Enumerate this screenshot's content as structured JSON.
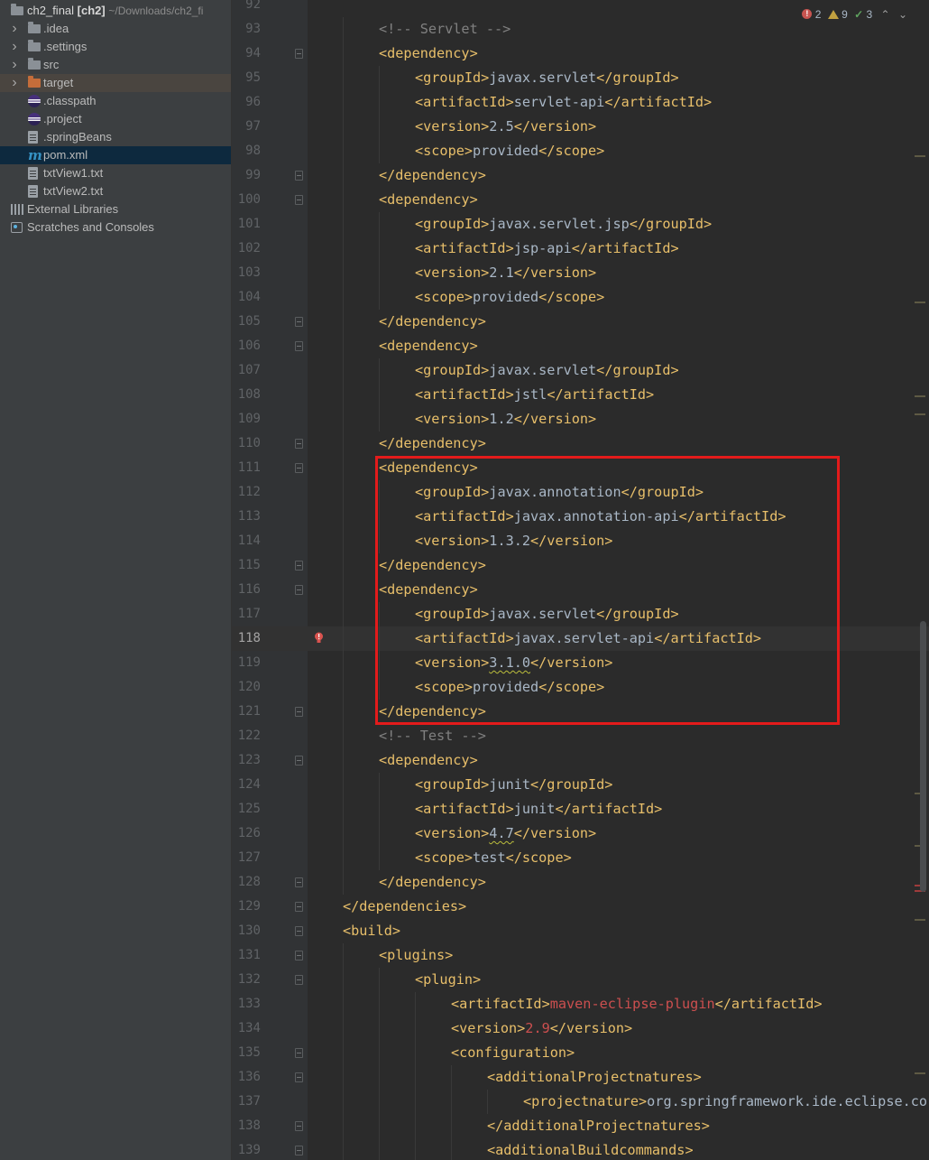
{
  "sidebar": {
    "root": {
      "name": "ch2_final",
      "module": "[ch2]",
      "path": "~/Downloads/ch2_fi"
    },
    "items": [
      {
        "label": ".idea",
        "kind": "folder",
        "expandable": true
      },
      {
        "label": ".settings",
        "kind": "folder",
        "expandable": true
      },
      {
        "label": "src",
        "kind": "folder",
        "expandable": true
      },
      {
        "label": "target",
        "kind": "folder-orange",
        "expandable": true
      },
      {
        "label": ".classpath",
        "kind": "eclipse-file"
      },
      {
        "label": ".project",
        "kind": "eclipse-file"
      },
      {
        "label": ".springBeans",
        "kind": "file"
      },
      {
        "label": "pom.xml",
        "kind": "maven-file",
        "selected": true
      },
      {
        "label": "txtView1.txt",
        "kind": "file"
      },
      {
        "label": "txtView2.txt",
        "kind": "file"
      }
    ],
    "external_libraries": "External Libraries",
    "scratches": "Scratches and Consoles"
  },
  "inspections": {
    "errors": "2",
    "warnings": "9",
    "weak_warnings": "3"
  },
  "editor": {
    "first_partial_line": "92",
    "current_line": "118",
    "lines": [
      {
        "n": "93",
        "indent": 2,
        "parts": [
          [
            "cmt",
            "<!-- Servlet -->"
          ]
        ]
      },
      {
        "n": "94",
        "indent": 2,
        "fold": "open",
        "parts": [
          [
            "tag",
            "<dependency>"
          ]
        ]
      },
      {
        "n": "95",
        "indent": 3,
        "parts": [
          [
            "tag",
            "<groupId>"
          ],
          [
            "txt",
            "javax.servlet"
          ],
          [
            "tag",
            "</groupId>"
          ]
        ]
      },
      {
        "n": "96",
        "indent": 3,
        "parts": [
          [
            "tag",
            "<artifactId>"
          ],
          [
            "txt",
            "servlet-api"
          ],
          [
            "tag",
            "</artifactId>"
          ]
        ]
      },
      {
        "n": "97",
        "indent": 3,
        "parts": [
          [
            "tag",
            "<version>"
          ],
          [
            "txt",
            "2.5"
          ],
          [
            "tag",
            "</version>"
          ]
        ]
      },
      {
        "n": "98",
        "indent": 3,
        "parts": [
          [
            "tag",
            "<scope>"
          ],
          [
            "txt",
            "provided"
          ],
          [
            "tag",
            "</scope>"
          ]
        ]
      },
      {
        "n": "99",
        "indent": 2,
        "fold": "close",
        "parts": [
          [
            "tag",
            "</dependency>"
          ]
        ]
      },
      {
        "n": "100",
        "indent": 2,
        "fold": "open",
        "parts": [
          [
            "tag",
            "<dependency>"
          ]
        ]
      },
      {
        "n": "101",
        "indent": 3,
        "parts": [
          [
            "tag",
            "<groupId>"
          ],
          [
            "txt",
            "javax.servlet.jsp"
          ],
          [
            "tag",
            "</groupId>"
          ]
        ]
      },
      {
        "n": "102",
        "indent": 3,
        "parts": [
          [
            "tag",
            "<artifactId>"
          ],
          [
            "txt",
            "jsp-api"
          ],
          [
            "tag",
            "</artifactId>"
          ]
        ]
      },
      {
        "n": "103",
        "indent": 3,
        "parts": [
          [
            "tag",
            "<version>"
          ],
          [
            "txt",
            "2.1"
          ],
          [
            "tag",
            "</version>"
          ]
        ]
      },
      {
        "n": "104",
        "indent": 3,
        "parts": [
          [
            "tag",
            "<scope>"
          ],
          [
            "txt",
            "provided"
          ],
          [
            "tag",
            "</scope>"
          ]
        ]
      },
      {
        "n": "105",
        "indent": 2,
        "fold": "close",
        "parts": [
          [
            "tag",
            "</dependency>"
          ]
        ]
      },
      {
        "n": "106",
        "indent": 2,
        "fold": "open",
        "parts": [
          [
            "tag",
            "<dependency>"
          ]
        ]
      },
      {
        "n": "107",
        "indent": 3,
        "parts": [
          [
            "tag",
            "<groupId>"
          ],
          [
            "txt",
            "javax.servlet"
          ],
          [
            "tag",
            "</groupId>"
          ]
        ]
      },
      {
        "n": "108",
        "indent": 3,
        "parts": [
          [
            "tag",
            "<artifactId>"
          ],
          [
            "txt",
            "jstl"
          ],
          [
            "tag",
            "</artifactId>"
          ]
        ]
      },
      {
        "n": "109",
        "indent": 3,
        "parts": [
          [
            "tag",
            "<version>"
          ],
          [
            "txt",
            "1.2"
          ],
          [
            "tag",
            "</version>"
          ]
        ]
      },
      {
        "n": "110",
        "indent": 2,
        "fold": "close",
        "parts": [
          [
            "tag",
            "</dependency>"
          ]
        ]
      },
      {
        "n": "111",
        "indent": 2,
        "fold": "open",
        "parts": [
          [
            "tag",
            "<dependency>"
          ]
        ]
      },
      {
        "n": "112",
        "indent": 3,
        "parts": [
          [
            "tag",
            "<groupId>"
          ],
          [
            "txt",
            "javax.annotation"
          ],
          [
            "tag",
            "</groupId>"
          ]
        ]
      },
      {
        "n": "113",
        "indent": 3,
        "parts": [
          [
            "tag",
            "<artifactId>"
          ],
          [
            "txt",
            "javax.annotation-api"
          ],
          [
            "tag",
            "</artifactId>"
          ]
        ]
      },
      {
        "n": "114",
        "indent": 3,
        "parts": [
          [
            "tag",
            "<version>"
          ],
          [
            "txt",
            "1.3.2"
          ],
          [
            "tag",
            "</version>"
          ]
        ]
      },
      {
        "n": "115",
        "indent": 2,
        "fold": "close",
        "parts": [
          [
            "tag",
            "</dependency>"
          ]
        ]
      },
      {
        "n": "116",
        "indent": 2,
        "fold": "open",
        "parts": [
          [
            "tag",
            "<dependency>"
          ]
        ]
      },
      {
        "n": "117",
        "indent": 3,
        "parts": [
          [
            "tag",
            "<groupId>"
          ],
          [
            "txt",
            "javax.servlet"
          ],
          [
            "tag",
            "</groupId>"
          ]
        ]
      },
      {
        "n": "118",
        "indent": 3,
        "bulb": true,
        "parts": [
          [
            "tag",
            "<artifactId>"
          ],
          [
            "txt",
            "javax.servlet-api"
          ],
          [
            "tag",
            "</artifactId>"
          ]
        ]
      },
      {
        "n": "119",
        "indent": 3,
        "parts": [
          [
            "tag",
            "<version>"
          ],
          [
            "squig",
            "3.1.0"
          ],
          [
            "tag",
            "</version>"
          ]
        ]
      },
      {
        "n": "120",
        "indent": 3,
        "parts": [
          [
            "tag",
            "<scope>"
          ],
          [
            "txt",
            "provided"
          ],
          [
            "tag",
            "</scope>"
          ]
        ]
      },
      {
        "n": "121",
        "indent": 2,
        "fold": "close",
        "parts": [
          [
            "tag",
            "</dependency>"
          ]
        ]
      },
      {
        "n": "122",
        "indent": 2,
        "parts": [
          [
            "cmt",
            "<!-- Test -->"
          ]
        ]
      },
      {
        "n": "123",
        "indent": 2,
        "fold": "open",
        "parts": [
          [
            "tag",
            "<dependency>"
          ]
        ]
      },
      {
        "n": "124",
        "indent": 3,
        "parts": [
          [
            "tag",
            "<groupId>"
          ],
          [
            "txt",
            "junit"
          ],
          [
            "tag",
            "</groupId>"
          ]
        ]
      },
      {
        "n": "125",
        "indent": 3,
        "parts": [
          [
            "tag",
            "<artifactId>"
          ],
          [
            "txt",
            "junit"
          ],
          [
            "tag",
            "</artifactId>"
          ]
        ]
      },
      {
        "n": "126",
        "indent": 3,
        "parts": [
          [
            "tag",
            "<version>"
          ],
          [
            "squig",
            "4.7"
          ],
          [
            "tag",
            "</version>"
          ]
        ]
      },
      {
        "n": "127",
        "indent": 3,
        "parts": [
          [
            "tag",
            "<scope>"
          ],
          [
            "txt",
            "test"
          ],
          [
            "tag",
            "</scope>"
          ]
        ]
      },
      {
        "n": "128",
        "indent": 2,
        "fold": "close",
        "parts": [
          [
            "tag",
            "</dependency>"
          ]
        ]
      },
      {
        "n": "129",
        "indent": 1,
        "fold": "close",
        "parts": [
          [
            "tag",
            "</dependencies>"
          ]
        ]
      },
      {
        "n": "130",
        "indent": 1,
        "fold": "open",
        "parts": [
          [
            "tag",
            "<build>"
          ]
        ]
      },
      {
        "n": "131",
        "indent": 2,
        "fold": "open",
        "parts": [
          [
            "tag",
            "<plugins>"
          ]
        ]
      },
      {
        "n": "132",
        "indent": 3,
        "fold": "open",
        "parts": [
          [
            "tag",
            "<plugin>"
          ]
        ]
      },
      {
        "n": "133",
        "indent": 4,
        "parts": [
          [
            "tag",
            "<artifactId>"
          ],
          [
            "red",
            "maven-eclipse-plugin"
          ],
          [
            "tag",
            "</artifactId>"
          ]
        ]
      },
      {
        "n": "134",
        "indent": 4,
        "parts": [
          [
            "tag",
            "<version>"
          ],
          [
            "red",
            "2.9"
          ],
          [
            "tag",
            "</version>"
          ]
        ]
      },
      {
        "n": "135",
        "indent": 4,
        "fold": "open",
        "parts": [
          [
            "tag",
            "<configuration>"
          ]
        ]
      },
      {
        "n": "136",
        "indent": 5,
        "fold": "open",
        "parts": [
          [
            "tag",
            "<additionalProjectnatures>"
          ]
        ]
      },
      {
        "n": "137",
        "indent": 6,
        "parts": [
          [
            "tag",
            "<projectnature>"
          ],
          [
            "txt",
            "org.springframework.ide.eclipse.core.springnature"
          ]
        ]
      },
      {
        "n": "138",
        "indent": 5,
        "fold": "close",
        "parts": [
          [
            "tag",
            "</additionalProjectnatures>"
          ]
        ]
      },
      {
        "n": "139",
        "indent": 5,
        "fold": "open",
        "parts": [
          [
            "tag",
            "<additionalBuildcommands>"
          ]
        ]
      }
    ]
  }
}
